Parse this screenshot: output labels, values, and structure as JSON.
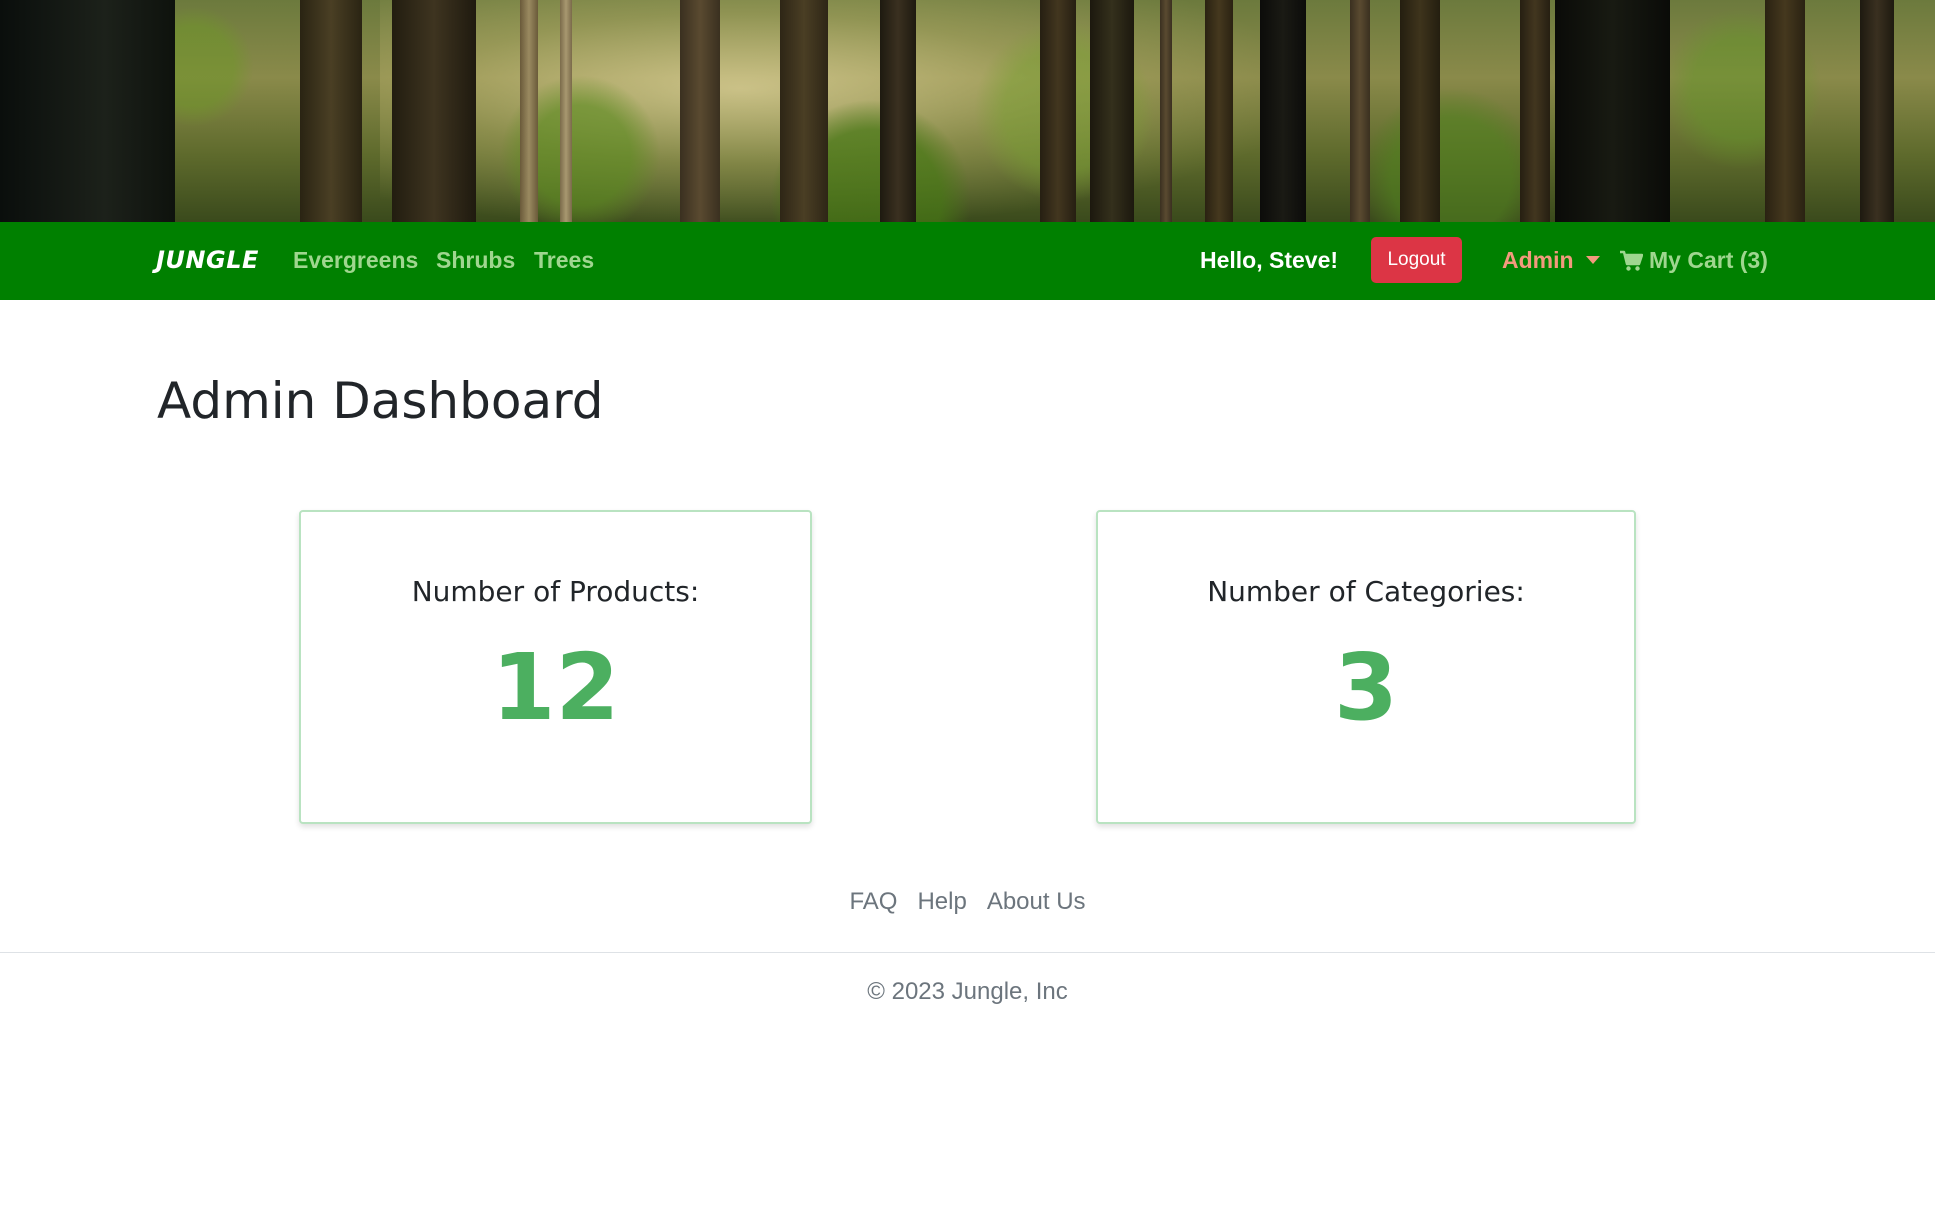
{
  "navbar": {
    "brand": "JUNGLE",
    "links": [
      {
        "label": "Evergreens"
      },
      {
        "label": "Shrubs"
      },
      {
        "label": "Trees"
      }
    ],
    "greeting": "Hello, Steve!",
    "logout_label": "Logout",
    "admin_label": "Admin",
    "cart_label": "My Cart (3)",
    "cart_icon": "shopping-cart-icon",
    "background_color": "#008000"
  },
  "main": {
    "title": "Admin Dashboard",
    "cards": [
      {
        "label": "Number of Products:",
        "value": "12"
      },
      {
        "label": "Number of Categories:",
        "value": "3"
      }
    ],
    "value_color": "#4caf60"
  },
  "footer": {
    "links": [
      {
        "label": "FAQ"
      },
      {
        "label": "Help"
      },
      {
        "label": "About Us"
      }
    ],
    "copyright": "© 2023 Jungle, Inc"
  },
  "colors": {
    "logout": "#dc3545",
    "admin": "#f39a7d",
    "nav_link": "#9fd68f"
  }
}
